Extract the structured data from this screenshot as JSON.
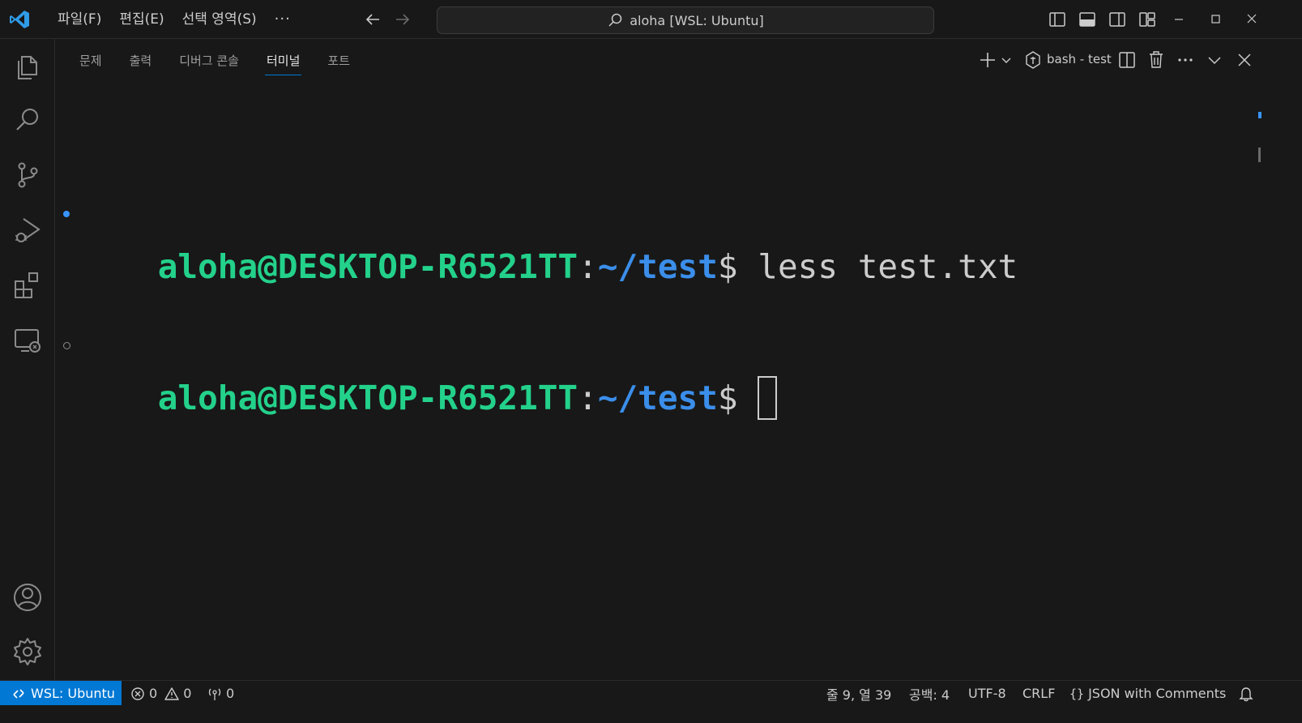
{
  "window": {
    "search_text": "aloha [WSL: Ubuntu]"
  },
  "menu": [
    "파일(F)",
    "편집(E)",
    "선택 영역(S)",
    "···"
  ],
  "panel": {
    "tabs": [
      "문제",
      "출력",
      "디버그 콘솔",
      "터미널",
      "포트"
    ],
    "active_tab": "터미널",
    "terminal_name": "bash - test"
  },
  "terminal": {
    "lines": [
      {
        "user": "aloha@DESKTOP-R6521TT",
        "colon": ":",
        "path": "~/test",
        "dollar": "$",
        "cmd": " less test.txt"
      },
      {
        "user": "aloha@DESKTOP-R6521TT",
        "colon": ":",
        "path": "~/test",
        "dollar": "$",
        "cmd": " "
      }
    ]
  },
  "statusbar": {
    "remote": "WSL: Ubuntu",
    "errors": "0",
    "warnings": "0",
    "ports": "0",
    "position": "줄 9, 열 39",
    "spaces": "공백: 4",
    "encoding": "UTF-8",
    "eol": "CRLF",
    "language": "JSON with Comments"
  },
  "colors": {
    "accent": "#0078d4",
    "user_green": "#23d18b",
    "path_blue": "#3b8eea",
    "background": "#181818"
  }
}
